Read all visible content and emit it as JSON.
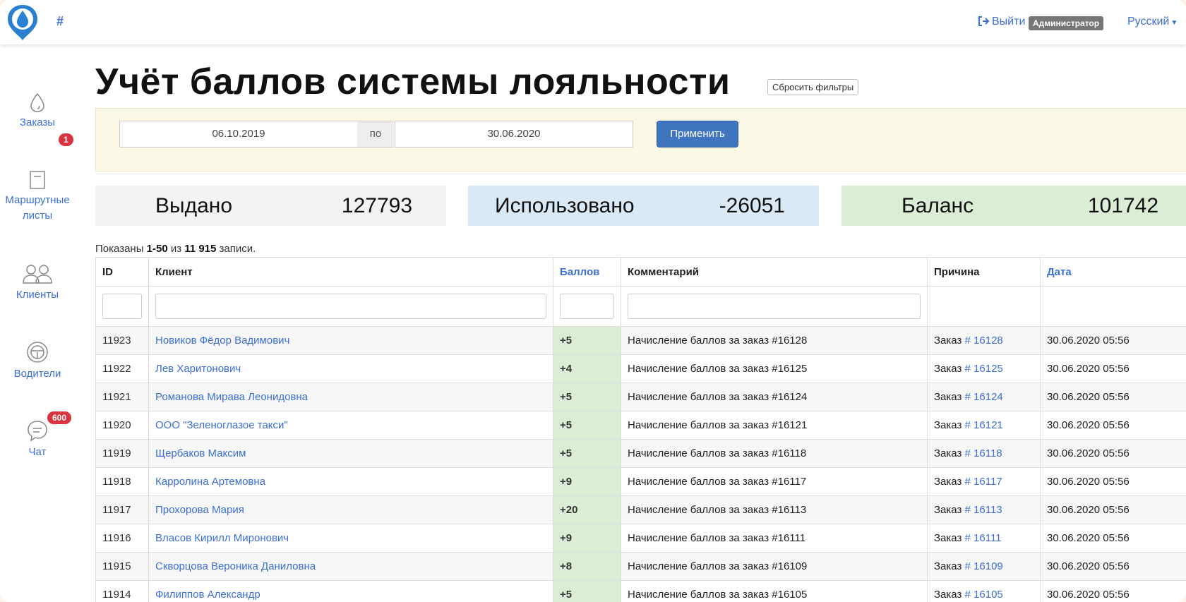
{
  "topbar": {
    "home_hash": "#",
    "logout_label": "Выйти",
    "role_badge": "Администратор",
    "language": "Русский"
  },
  "sidebar": {
    "items": [
      {
        "label": "Заказы",
        "icon": "drop-icon",
        "badge": "1"
      },
      {
        "label": "Маршрутные листы",
        "icon": "document-icon",
        "badge": ""
      },
      {
        "label": "Клиенты",
        "icon": "users-icon",
        "badge": ""
      },
      {
        "label": "Водители",
        "icon": "steering-wheel-icon",
        "badge": ""
      },
      {
        "label": "Чат",
        "icon": "chat-icon",
        "badge": "600"
      }
    ]
  },
  "page": {
    "title": "Учёт баллов системы лояльности",
    "reset_filters": "Сбросить фильтры"
  },
  "filter": {
    "date_from": "06.10.2019",
    "separator": "по",
    "date_to": "30.06.2020",
    "apply_label": "Применить"
  },
  "stats": {
    "issued_label": "Выдано",
    "issued_value": "127793",
    "used_label": "Использовано",
    "used_value": "-26051",
    "balance_label": "Баланс",
    "balance_value": "101742"
  },
  "summary": {
    "prefix": "Показаны",
    "range": "1-50",
    "of": "из",
    "total": "11 915",
    "suffix": "записи."
  },
  "table": {
    "headers": {
      "id": "ID",
      "client": "Клиент",
      "points": "Баллов",
      "comment": "Комментарий",
      "reason": "Причина",
      "date": "Дата"
    },
    "rows": [
      {
        "id": "11923",
        "client": "Новиков Фёдор Вадимович",
        "points": "+5",
        "comment": "Начисление баллов за заказ #16128",
        "reason_prefix": "Заказ",
        "order": "# 16128",
        "date": "30.06.2020 05:56"
      },
      {
        "id": "11922",
        "client": "Лев Харитонович",
        "points": "+4",
        "comment": "Начисление баллов за заказ #16125",
        "reason_prefix": "Заказ",
        "order": "# 16125",
        "date": "30.06.2020 05:56"
      },
      {
        "id": "11921",
        "client": "Романова Мирава Леонидовна",
        "points": "+5",
        "comment": "Начисление баллов за заказ #16124",
        "reason_prefix": "Заказ",
        "order": "# 16124",
        "date": "30.06.2020 05:56"
      },
      {
        "id": "11920",
        "client": "ООО \"Зеленоглазое такси\"",
        "points": "+5",
        "comment": "Начисление баллов за заказ #16121",
        "reason_prefix": "Заказ",
        "order": "# 16121",
        "date": "30.06.2020 05:56"
      },
      {
        "id": "11919",
        "client": "Щербаков Максим",
        "points": "+5",
        "comment": "Начисление баллов за заказ #16118",
        "reason_prefix": "Заказ",
        "order": "# 16118",
        "date": "30.06.2020 05:56"
      },
      {
        "id": "11918",
        "client": "Карролина Артемовна",
        "points": "+9",
        "comment": "Начисление баллов за заказ #16117",
        "reason_prefix": "Заказ",
        "order": "# 16117",
        "date": "30.06.2020 05:56"
      },
      {
        "id": "11917",
        "client": "Прохорова Мария",
        "points": "+20",
        "comment": "Начисление баллов за заказ #16113",
        "reason_prefix": "Заказ",
        "order": "# 16113",
        "date": "30.06.2020 05:56"
      },
      {
        "id": "11916",
        "client": "Власов Кирилл Миронович",
        "points": "+9",
        "comment": "Начисление баллов за заказ #16111",
        "reason_prefix": "Заказ",
        "order": "# 16111",
        "date": "30.06.2020 05:56"
      },
      {
        "id": "11915",
        "client": "Скворцова Вероника Даниловна",
        "points": "+8",
        "comment": "Начисление баллов за заказ #16109",
        "reason_prefix": "Заказ",
        "order": "# 16109",
        "date": "30.06.2020 05:56"
      },
      {
        "id": "11914",
        "client": "Филиппов Александр",
        "points": "+5",
        "comment": "Начисление баллов за заказ #16105",
        "reason_prefix": "Заказ",
        "order": "# 16105",
        "date": "30.06.2020 05:56"
      }
    ]
  }
}
